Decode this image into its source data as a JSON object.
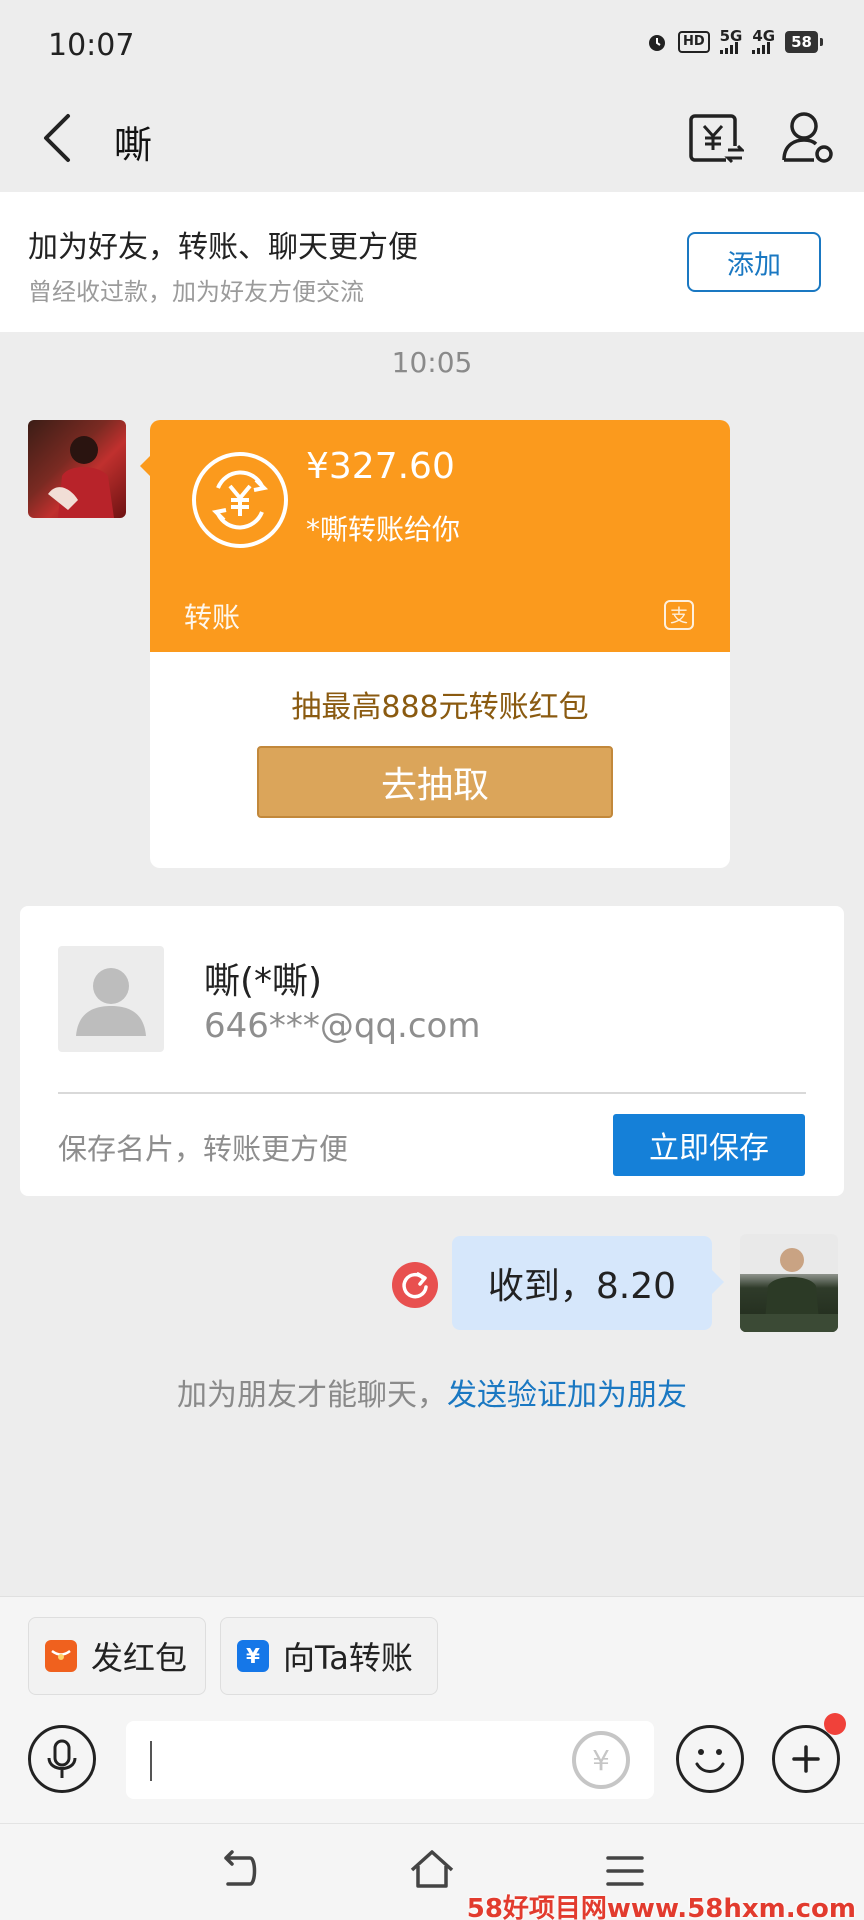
{
  "status_bar": {
    "time": "10:07",
    "network_hd": "HD",
    "network_5g": "5G",
    "network_4g": "4G",
    "battery": "58"
  },
  "title_bar": {
    "title": "嘶"
  },
  "friend_banner": {
    "title": "加为好友，转账、聊天更方便",
    "subtitle": "曾经收过款，加为好友方便交流",
    "add_label": "添加"
  },
  "timestamp": "10:05",
  "transfer_card": {
    "amount": "¥327.60",
    "description": "*嘶转账给你",
    "label": "转账",
    "promo_text": "抽最高888元转账红包",
    "draw_button": "去抽取",
    "accent_color": "#fb9a1d"
  },
  "contact_card": {
    "name": "嘶(*嘶)",
    "email": "646***@qq.com",
    "hint": "保存名片，转账更方便",
    "save_button": "立即保存"
  },
  "sent_message": {
    "text": "收到，8.20"
  },
  "friend_hint": {
    "text": "加为朋友才能聊天，",
    "link": "发送验证加为朋友"
  },
  "bottom_bar": {
    "red_packet_label": "发红包",
    "transfer_label": "向Ta转账",
    "yuan_symbol": "¥"
  },
  "watermark": "58好项目网www.58hxm.com"
}
